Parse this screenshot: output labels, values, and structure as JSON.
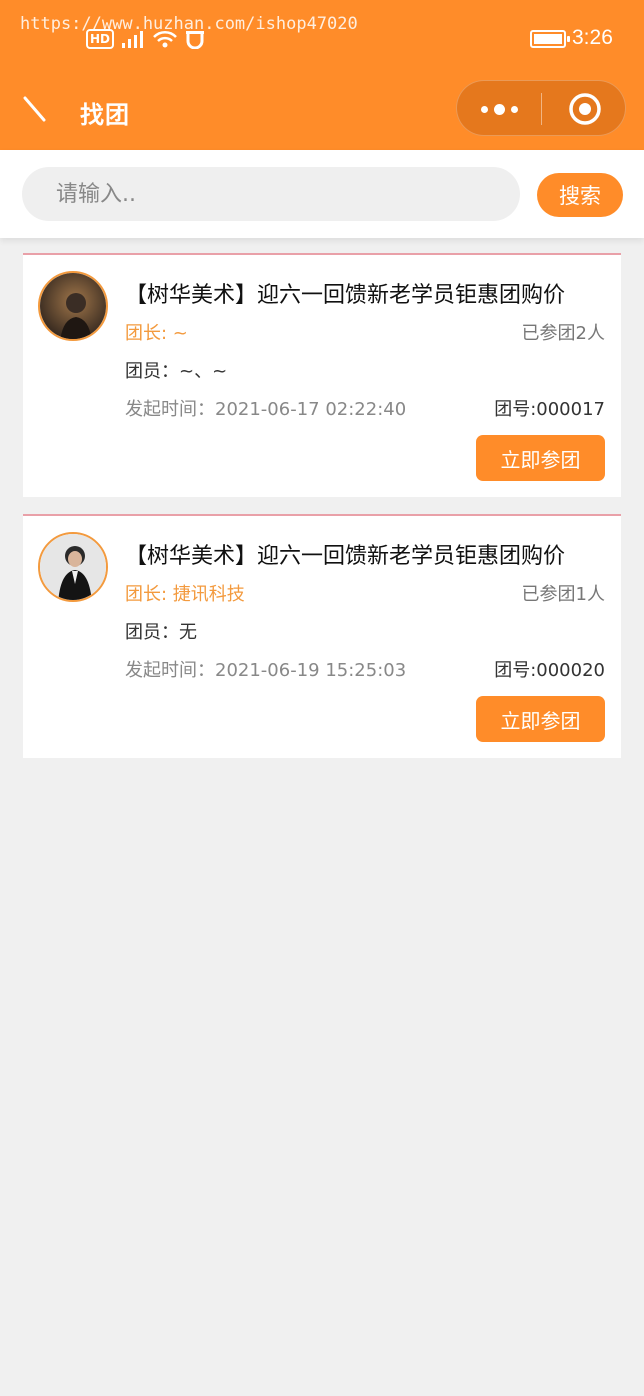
{
  "status_bar": {
    "watermark": "https://www.huzhan.com/ishop47020",
    "hd_label": "HD",
    "time": "3:26",
    "icons": [
      "signal-icon",
      "wifi-icon",
      "app-notification-icon",
      "battery-icon"
    ]
  },
  "nav": {
    "title": "找团",
    "back_icon": "back-icon",
    "more_icon": "more-dots-icon",
    "close_icon": "target-close-icon"
  },
  "search": {
    "placeholder": "请输入..",
    "button_label": "搜索"
  },
  "groups": [
    {
      "title": "【树华美术】迎六一回馈新老学员钜惠团购价",
      "leader": "团长: ~",
      "joined": "已参团2人",
      "members": "团员：~、~",
      "start_time": "发起时间：2021-06-17 02:22:40",
      "group_no": "团号:000017",
      "join_label": "立即参团"
    },
    {
      "title": "【树华美术】迎六一回馈新老学员钜惠团购价",
      "leader": "团长: 捷讯科技",
      "joined": "已参团1人",
      "members": "团员：无",
      "start_time": "发起时间：2021-06-19 15:25:03",
      "group_no": "团号:000020",
      "join_label": "立即参团"
    }
  ],
  "colors": {
    "accent": "#ff8c29",
    "leader_text": "#f39a3e",
    "card_top_border": "#e9a0a8",
    "background": "#f0f0f0"
  }
}
